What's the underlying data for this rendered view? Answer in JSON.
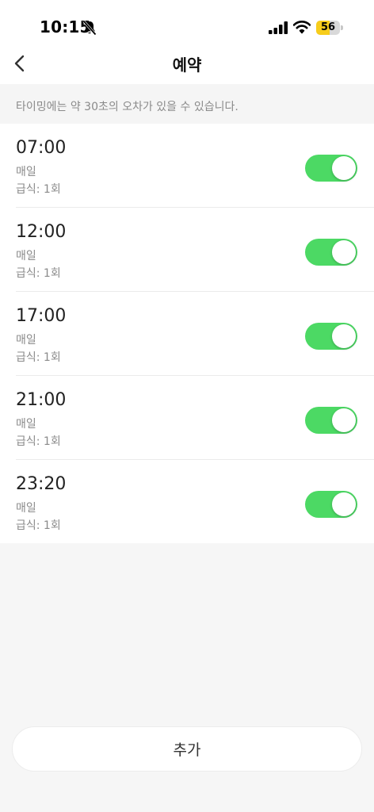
{
  "status_bar": {
    "time": "10:15",
    "battery_level": "56",
    "battery_fraction": 0.56,
    "icons": [
      "bell-slash-icon",
      "signal-icon",
      "wifi-icon",
      "battery-icon"
    ]
  },
  "header": {
    "title": "예약",
    "back_icon": "chevron-left-icon"
  },
  "notice": {
    "text": "타이밍에는 약 30초의 오차가 있을 수 있습니다."
  },
  "schedules": [
    {
      "time": "07:00",
      "repeat": "매일",
      "portion": "급식: 1회",
      "enabled": true
    },
    {
      "time": "12:00",
      "repeat": "매일",
      "portion": "급식: 1회",
      "enabled": true
    },
    {
      "time": "17:00",
      "repeat": "매일",
      "portion": "급식: 1회",
      "enabled": true
    },
    {
      "time": "21:00",
      "repeat": "매일",
      "portion": "급식: 1회",
      "enabled": true
    },
    {
      "time": "23:20",
      "repeat": "매일",
      "portion": "급식: 1회",
      "enabled": true
    }
  ],
  "footer": {
    "add_label": "추가"
  },
  "colors": {
    "toggle_on": "#4cd964",
    "battery": "#f7cd1b",
    "background": "#f6f6f6"
  }
}
